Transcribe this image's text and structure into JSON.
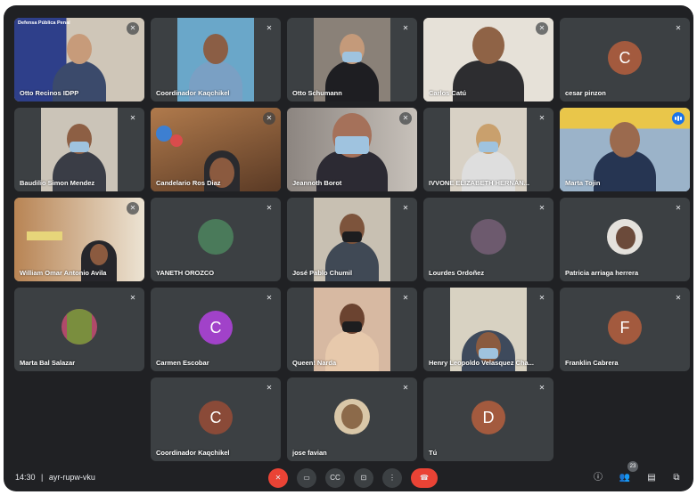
{
  "meeting": {
    "time": "14:30",
    "separator": "|",
    "code": "ayr-rupw-vku"
  },
  "participants": [
    {
      "name": "Otto Recinos IDPP",
      "banner": "Defensa Pública Penal"
    },
    {
      "name": "Coordinador Kaqchikel"
    },
    {
      "name": "Otto Schumann"
    },
    {
      "name": "Carlos Catú"
    },
    {
      "name": "cesar pinzon",
      "initial": "C"
    },
    {
      "name": "Baudilio Simon Mendez"
    },
    {
      "name": "Candelario Ros Diaz"
    },
    {
      "name": "Jeannoth Borot"
    },
    {
      "name": "IVVONE ELIZABETH HERNÁN..."
    },
    {
      "name": "Marta Tojin"
    },
    {
      "name": "William Omar Antonio Avila"
    },
    {
      "name": "YANETH OROZCO"
    },
    {
      "name": "José Pablo Chumil"
    },
    {
      "name": "Lourdes Ordoñez"
    },
    {
      "name": "Patricia arriaga herrera"
    },
    {
      "name": "Marta Bal Salazar"
    },
    {
      "name": "Carmen Escobar",
      "initial": "C"
    },
    {
      "name": "Queen! Narda"
    },
    {
      "name": "Henry Leopoldo Velasquez Cha..."
    },
    {
      "name": "Franklin Cabrera",
      "initial": "F"
    },
    {
      "name": "Coordinador Kaqchikel",
      "initial": "C"
    },
    {
      "name": "jose favian"
    },
    {
      "name": "Tú",
      "initial": "D"
    }
  ],
  "people_count": "23",
  "colors": {
    "accent": "#1a73e8",
    "danger": "#ea4335",
    "background": "#202124",
    "tile": "#3c4043"
  },
  "icons": [
    "mic-off-icon",
    "camera-icon",
    "captions-icon",
    "present-icon",
    "more-icon",
    "hangup-icon",
    "info-icon",
    "people-icon",
    "chat-icon",
    "activities-icon"
  ]
}
